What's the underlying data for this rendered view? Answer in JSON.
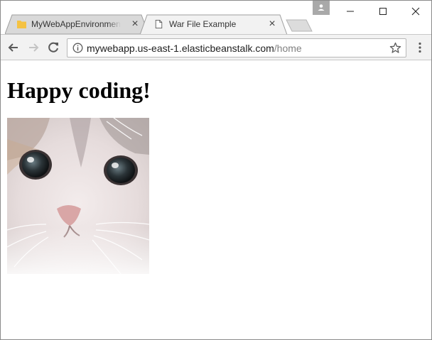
{
  "browser": {
    "tabs": [
      {
        "title": "MyWebAppEnvironment",
        "active": false,
        "favicon": "folder-icon"
      },
      {
        "title": "War File Example",
        "active": true,
        "favicon": "page-icon"
      }
    ],
    "address": {
      "host": "mywebapp.us-east-1.elasticbeanstalk.com",
      "path": "/home"
    },
    "icons": {
      "back": "back-arrow-icon",
      "forward": "forward-arrow-icon",
      "reload": "reload-icon",
      "info": "info-icon",
      "bookmark": "star-icon",
      "menu": "kebab-menu-icon",
      "profile": "user-icon",
      "minimize": "minimize-icon",
      "maximize": "maximize-icon",
      "close": "close-icon"
    }
  },
  "page": {
    "heading": "Happy coding!",
    "image": "cat-photo"
  },
  "colors": {
    "toolbar": "#f2f2f2",
    "tab_inactive": "#d9d9d9",
    "folder": "#f5c242",
    "url_path": "#808080"
  }
}
